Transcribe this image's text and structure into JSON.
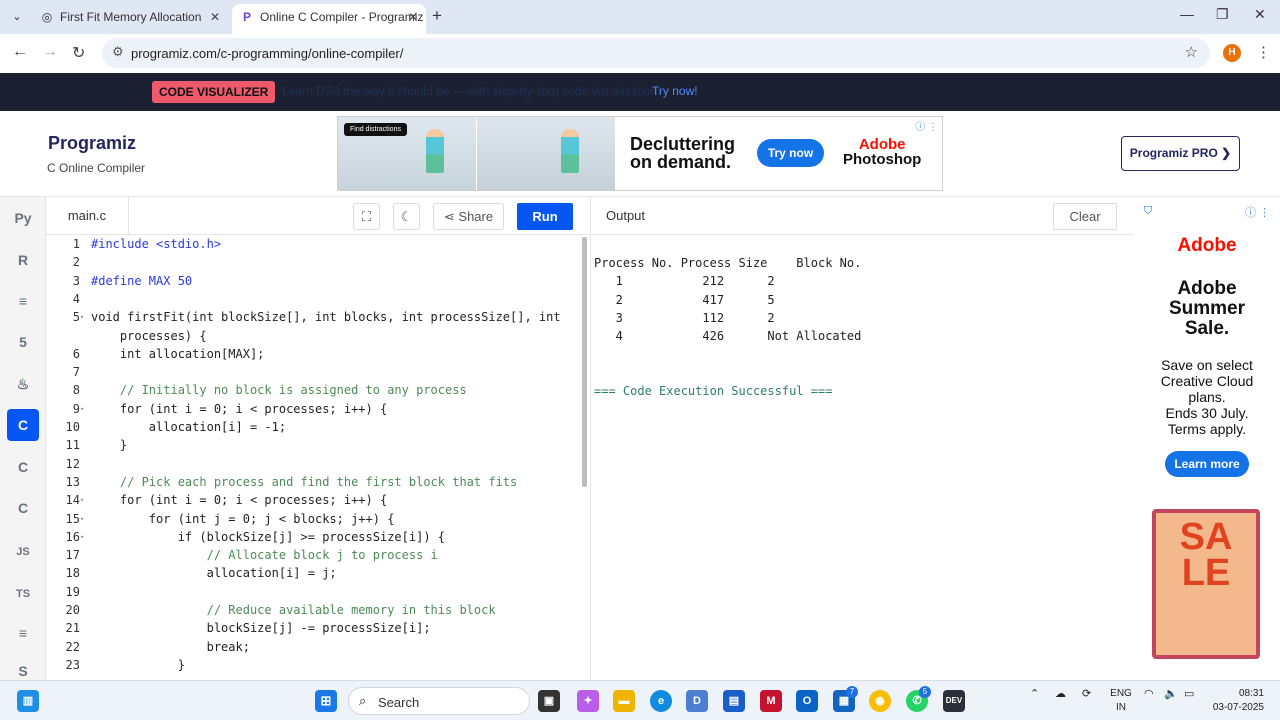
{
  "browser": {
    "tabs": [
      {
        "title": "First Fit Memory Allocation",
        "active": false
      },
      {
        "title": "Online C Compiler - Programiz",
        "active": true
      }
    ],
    "url": "programiz.com/c-programming/online-compiler/",
    "profile_initial": "H"
  },
  "promo": {
    "badge": "CODE VISUALIZER",
    "text": "Learn DSA the way it should be — with step-by-step code visualization.",
    "link": "Try now!"
  },
  "header": {
    "logo": "Programiz",
    "subtitle": "C Online Compiler",
    "pro_button": "Programiz PRO ❯",
    "ad": {
      "badge": "Find distractions",
      "headline_1": "Decluttering",
      "headline_2": "on demand.",
      "cta": "Try now",
      "brand_1": "Adobe",
      "brand_2": "Photoshop"
    }
  },
  "sidebar": {
    "items": [
      {
        "name": "python",
        "glyph": "Py"
      },
      {
        "name": "r",
        "glyph": "R"
      },
      {
        "name": "sql",
        "glyph": "≡"
      },
      {
        "name": "html",
        "glyph": "5"
      },
      {
        "name": "java",
        "glyph": "♨"
      },
      {
        "name": "c",
        "glyph": "C",
        "active": true
      },
      {
        "name": "cpp",
        "glyph": "C"
      },
      {
        "name": "csharp",
        "glyph": "C"
      },
      {
        "name": "js",
        "glyph": "JS"
      },
      {
        "name": "ts",
        "glyph": "TS"
      },
      {
        "name": "go",
        "glyph": "≡"
      },
      {
        "name": "swift",
        "glyph": "S"
      }
    ]
  },
  "editor": {
    "filename": "main.c",
    "share_label": "Share",
    "run_label": "Run",
    "lines": [
      {
        "n": "1",
        "text": "#include <stdio.h>"
      },
      {
        "n": "2",
        "text": ""
      },
      {
        "n": "3",
        "text": "#define MAX 50"
      },
      {
        "n": "4",
        "text": ""
      },
      {
        "n": "5",
        "text": "void firstFit(int blockSize[], int blocks, int processSize[], int"
      },
      {
        "n": "",
        "text": "    processes) {"
      },
      {
        "n": "6",
        "text": "    int allocation[MAX];"
      },
      {
        "n": "7",
        "text": ""
      },
      {
        "n": "8",
        "text": "    // Initially no block is assigned to any process"
      },
      {
        "n": "9",
        "text": "    for (int i = 0; i < processes; i++) {"
      },
      {
        "n": "10",
        "text": "        allocation[i] = -1;"
      },
      {
        "n": "11",
        "text": "    }"
      },
      {
        "n": "12",
        "text": ""
      },
      {
        "n": "13",
        "text": "    // Pick each process and find the first block that fits"
      },
      {
        "n": "14",
        "text": "    for (int i = 0; i < processes; i++) {"
      },
      {
        "n": "15",
        "text": "        for (int j = 0; j < blocks; j++) {"
      },
      {
        "n": "16",
        "text": "            if (blockSize[j] >= processSize[i]) {"
      },
      {
        "n": "17",
        "text": "                // Allocate block j to process i"
      },
      {
        "n": "18",
        "text": "                allocation[i] = j;"
      },
      {
        "n": "19",
        "text": ""
      },
      {
        "n": "20",
        "text": "                // Reduce available memory in this block"
      },
      {
        "n": "21",
        "text": "                blockSize[j] -= processSize[i];"
      },
      {
        "n": "22",
        "text": "                break;"
      },
      {
        "n": "23",
        "text": "            }"
      }
    ]
  },
  "output": {
    "title": "Output",
    "clear_label": "Clear",
    "lines": [
      "Process No. Process Size    Block No.",
      "   1           212      2",
      "   2           417      5",
      "   3           112      2",
      "   4           426      Not Allocated",
      "",
      "",
      "=== Code Execution Successful ==="
    ]
  },
  "right_ad": {
    "logo": "Adobe",
    "title_1": "Adobe",
    "title_2": "Summer",
    "title_3": "Sale.",
    "body_1": "Save on select",
    "body_2": "Creative Cloud",
    "body_3": "plans.",
    "body_4": "Ends 30 July.",
    "body_5": "Terms apply.",
    "cta": "Learn more",
    "sale_art": "SALE"
  },
  "taskbar": {
    "search_label": "Search",
    "lang_1": "ENG",
    "lang_2": "IN",
    "time": "08:31",
    "date": "03-07-2025",
    "badge_7": "7",
    "badge_5": "5"
  }
}
